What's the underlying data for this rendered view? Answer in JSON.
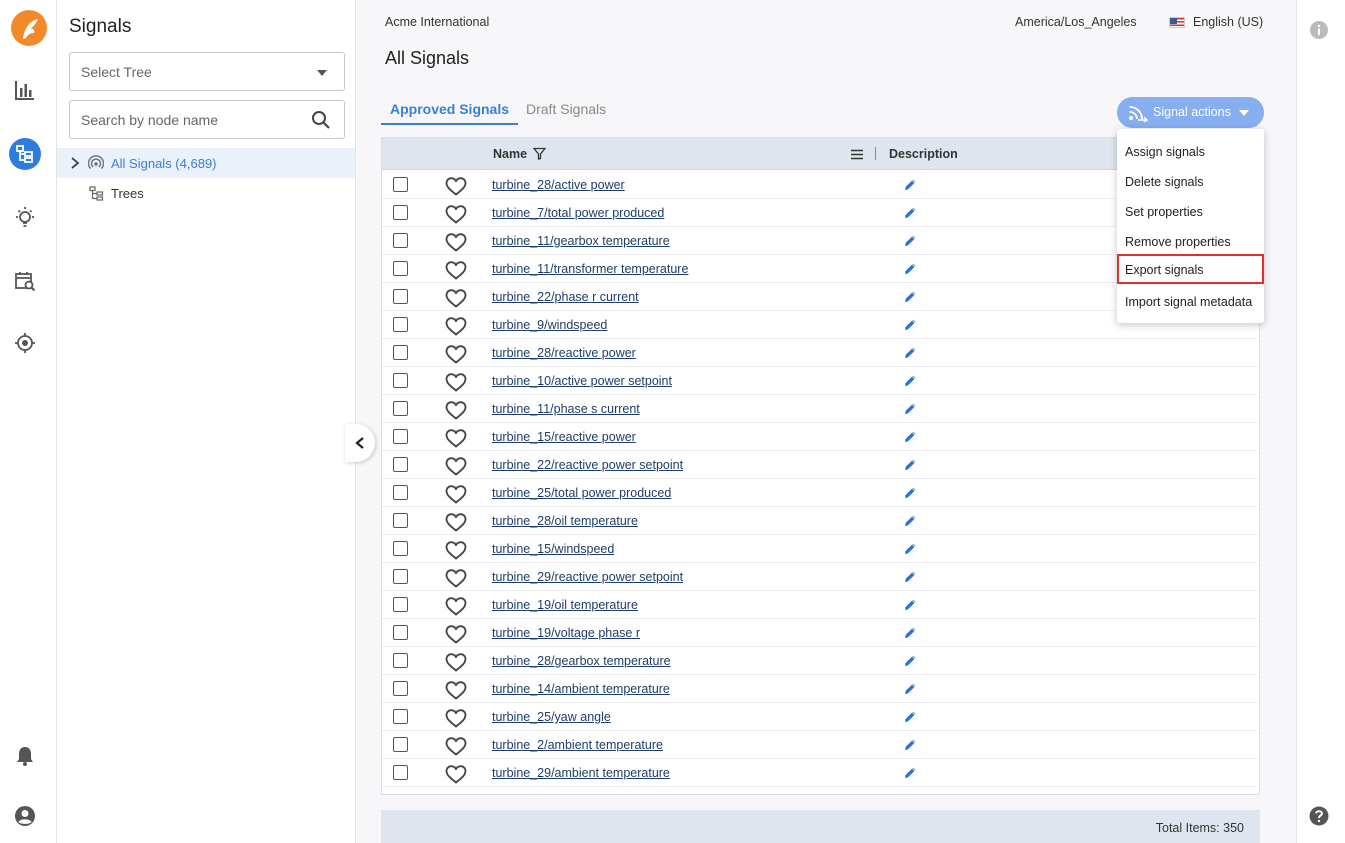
{
  "rail": {
    "icons": [
      "seeq-logo",
      "bar-chart-icon",
      "tree-icon",
      "lightbulb-icon",
      "calendar-search-icon",
      "target-icon",
      "bell-icon",
      "user-icon"
    ]
  },
  "tree": {
    "title": "Signals",
    "select_placeholder": "Select Tree",
    "search_placeholder": "Search by node name",
    "nodes": [
      {
        "label": "All Signals (4,689)"
      },
      {
        "label": "Trees"
      }
    ]
  },
  "header": {
    "org": "Acme International",
    "timezone": "America/Los_Angeles",
    "language": "English (US)"
  },
  "main": {
    "title": "All Signals",
    "tabs": [
      {
        "label": "Approved Signals"
      },
      {
        "label": "Draft Signals"
      }
    ],
    "signal_actions_label": "Signal actions"
  },
  "table": {
    "columns": {
      "name": "Name",
      "description": "Description"
    },
    "rows": [
      "turbine_28/active power",
      "turbine_7/total power produced",
      "turbine_11/gearbox temperature",
      "turbine_11/transformer temperature",
      "turbine_22/phase r current",
      "turbine_9/windspeed",
      "turbine_28/reactive power",
      "turbine_10/active power setpoint",
      "turbine_11/phase s current",
      "turbine_15/reactive power",
      "turbine_22/reactive power setpoint",
      "turbine_25/total power produced",
      "turbine_28/oil temperature",
      "turbine_15/windspeed",
      "turbine_29/reactive power setpoint",
      "turbine_19/oil temperature",
      "turbine_19/voltage phase r",
      "turbine_28/gearbox temperature",
      "turbine_14/ambient temperature",
      "turbine_25/yaw angle",
      "turbine_2/ambient temperature",
      "turbine_29/ambient temperature"
    ],
    "total_items": "Total Items: 350"
  },
  "menu": {
    "items": [
      {
        "label": "Assign signals"
      },
      {
        "label": "Delete signals"
      },
      {
        "label": "Set properties"
      },
      {
        "label": "Remove properties"
      },
      {
        "label": "Export signals"
      },
      {
        "label": "Import signal metadata"
      }
    ]
  },
  "colors": {
    "accent": "#3a7fd6",
    "logo": "#f28a2c",
    "button": "#86aef0",
    "highlight": "#e0302b"
  }
}
